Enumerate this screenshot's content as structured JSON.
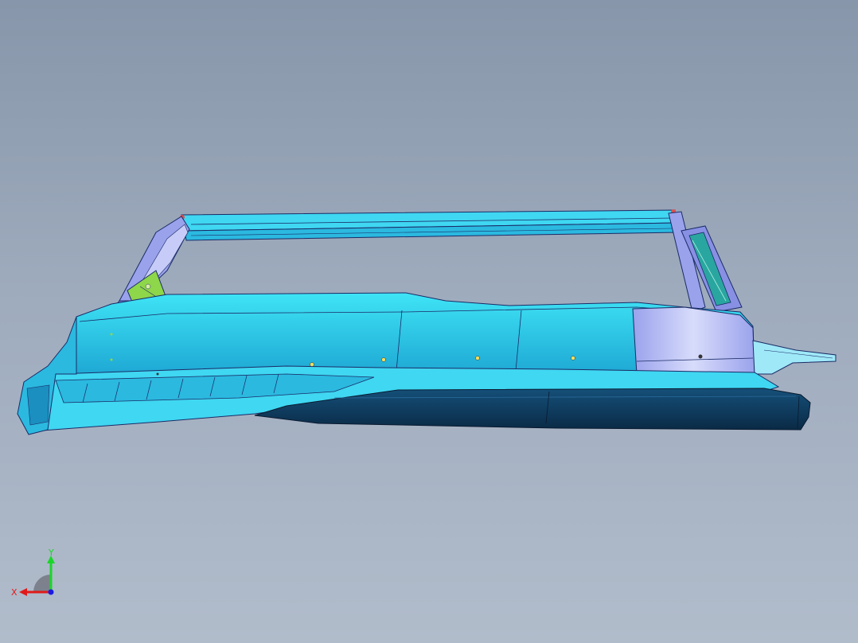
{
  "viewport": {
    "background_top": "#8796aa",
    "background_bottom": "#b1bccb"
  },
  "model": {
    "colors": {
      "cyan_body": "#26c9ec",
      "cyan_light": "#3fe4f6",
      "cyan_dark": "#1a9fc9",
      "lavender": "#9fa7ef",
      "lavender_light": "#c6ccf7",
      "navy_rocker": "#0f3f63",
      "navy_dark": "#0a2a45",
      "green_bracket": "#8ed64a",
      "edge": "#1a2b66"
    }
  },
  "triad": {
    "x_label": "X",
    "y_label": "Y",
    "x_color": "#e01a1a",
    "y_color": "#1ad62a",
    "z_color": "#1a1ae0"
  }
}
